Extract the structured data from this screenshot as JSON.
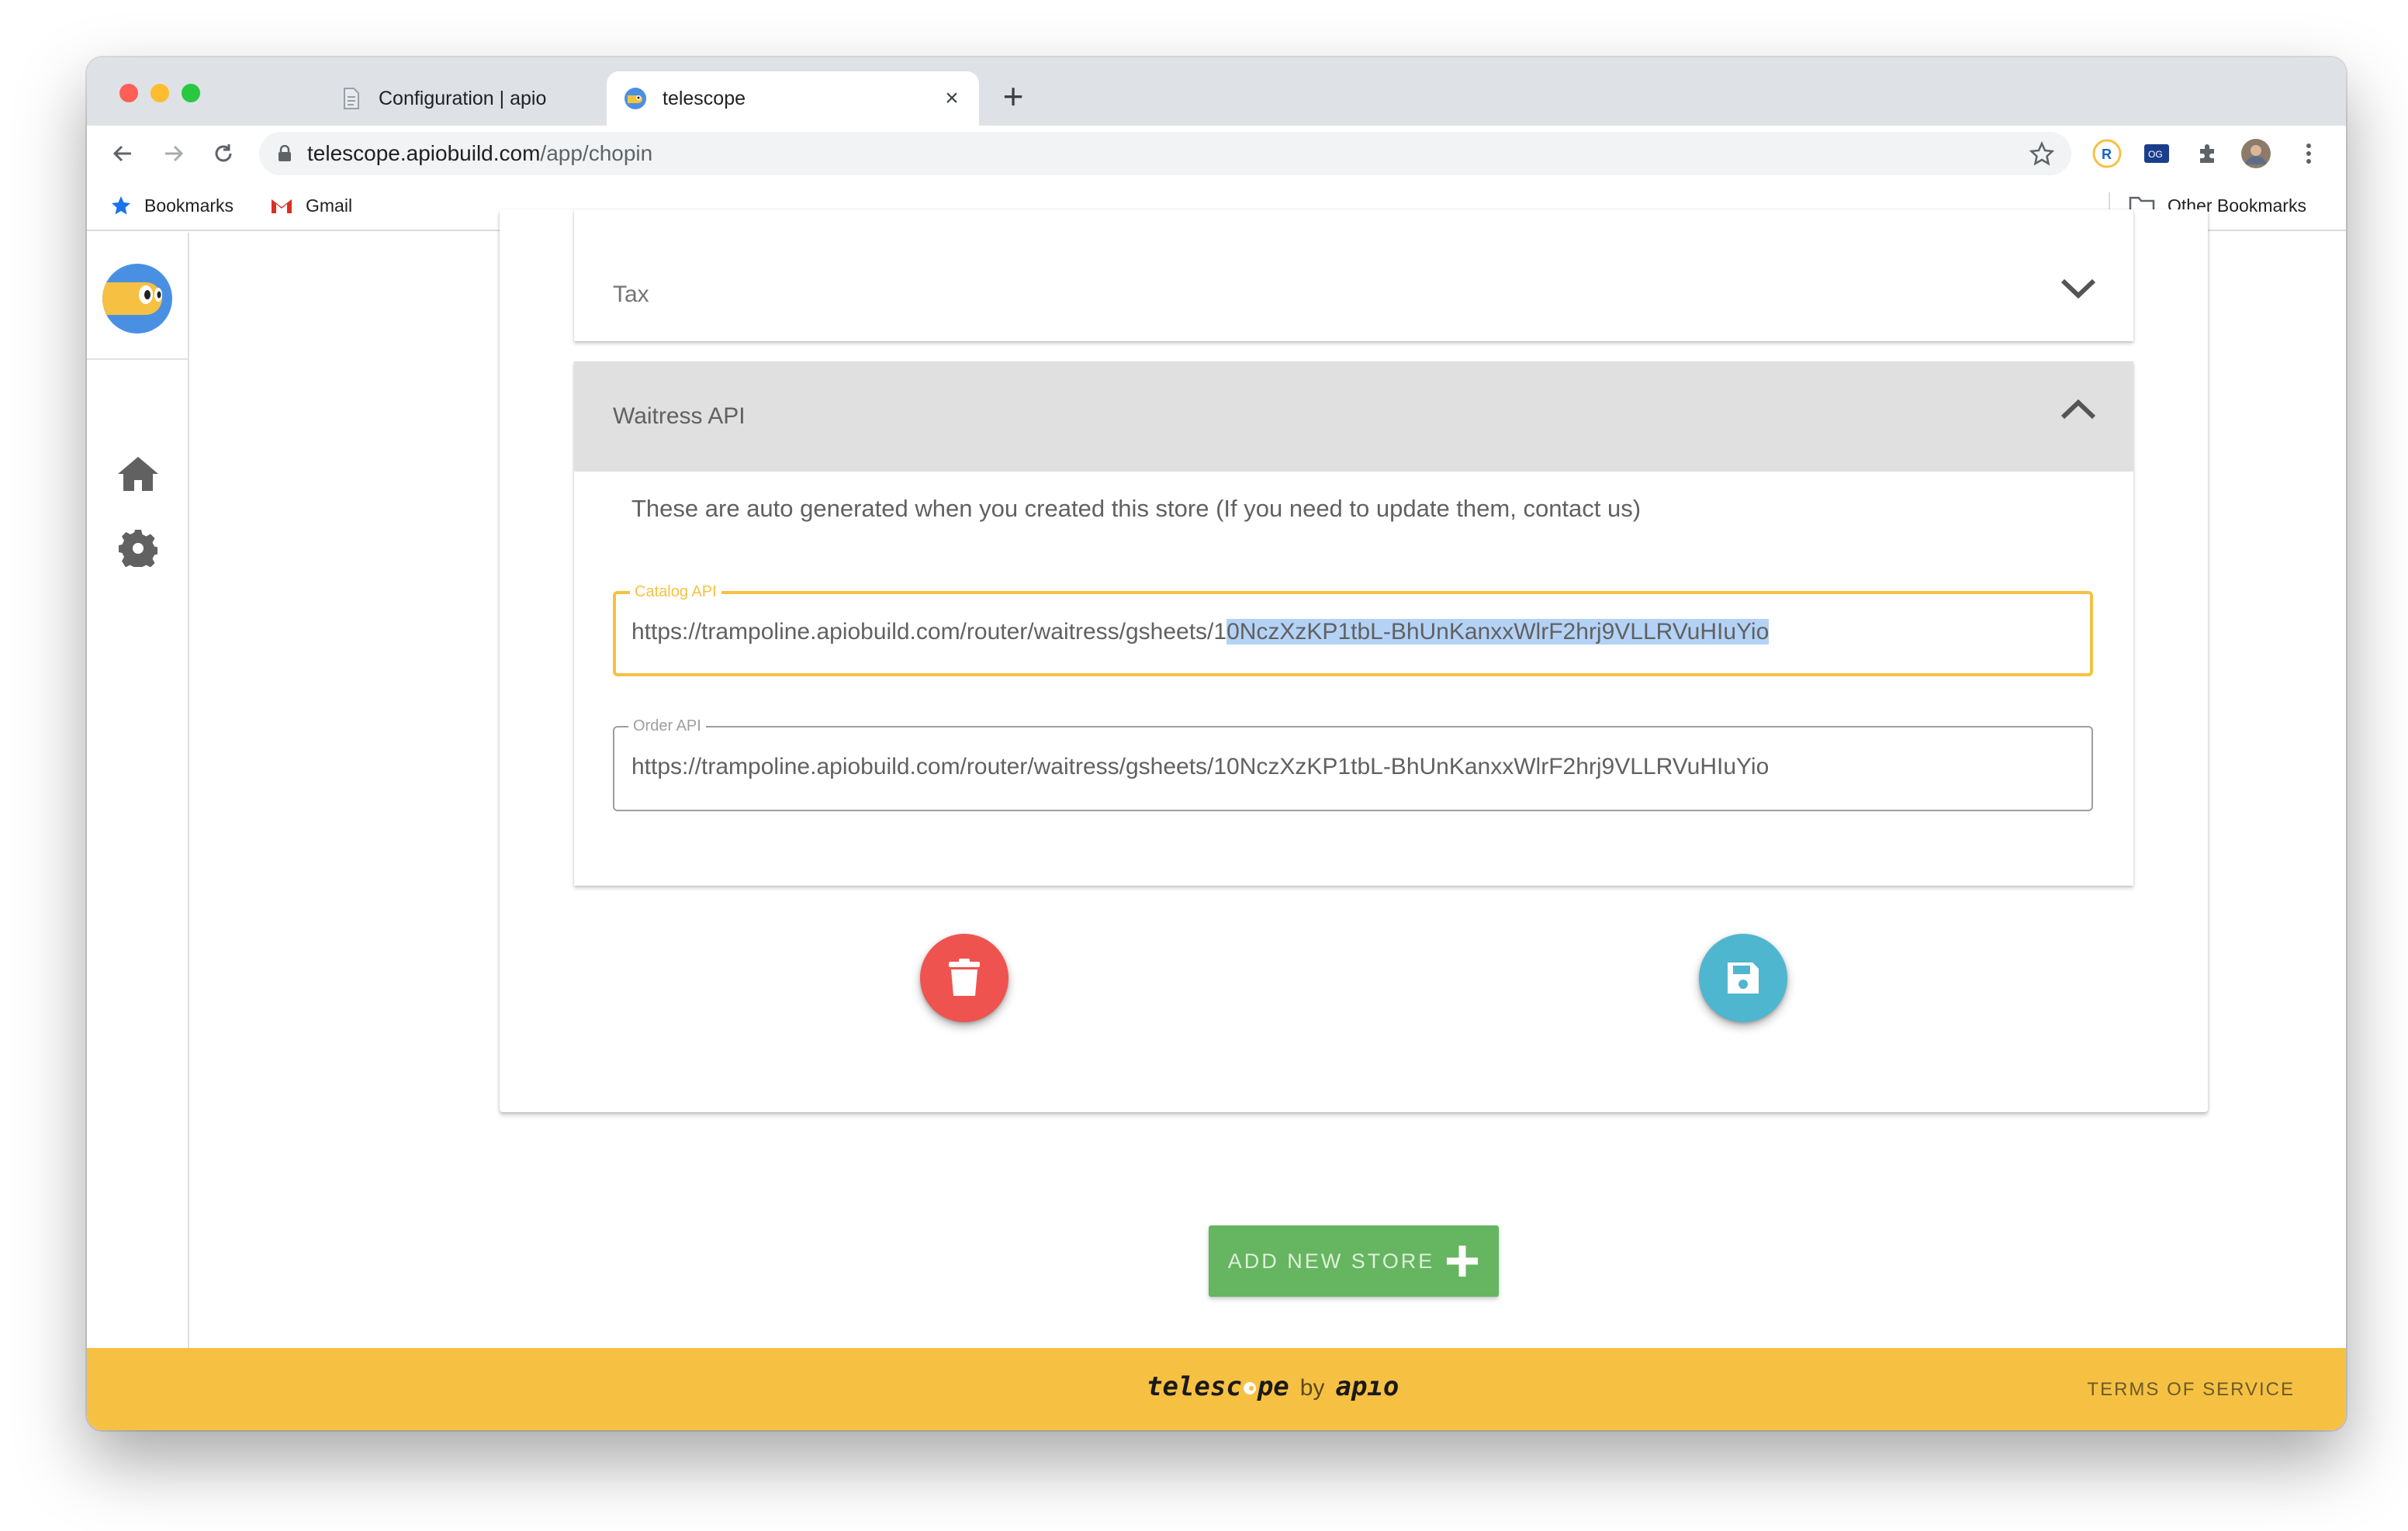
{
  "browser": {
    "tabs": [
      {
        "label": "Configuration | apio",
        "active": false
      },
      {
        "label": "telescope",
        "active": true
      }
    ],
    "url_host": "telescope.apiobuild.com",
    "url_path": "/app/chopin",
    "bookmarks": [
      {
        "label": "Bookmarks"
      },
      {
        "label": "Gmail"
      }
    ],
    "other_bookmarks": "Other Bookmarks"
  },
  "sidebar": {
    "items": [
      {
        "name": "home"
      },
      {
        "name": "settings"
      }
    ]
  },
  "panels": {
    "tax": {
      "title": "Tax",
      "expanded": false
    },
    "waitress": {
      "title": "Waitress API",
      "expanded": true,
      "description": "These are auto generated when you created this store (If you need to update them, contact us)",
      "catalog": {
        "label": "Catalog API",
        "value_prefix": "https://trampoline.apiobuild.com/router/waitress/gsheets/1",
        "value_selected": "0NczXzKP1tbL-BhUnKanxxWlrF2hrj9VLLRVuHIuYio"
      },
      "order": {
        "label": "Order API",
        "value": "https://trampoline.apiobuild.com/router/waitress/gsheets/10NczXzKP1tbL-BhUnKanxxWlrF2hrj9VLLRVuHIuYio"
      }
    }
  },
  "actions": {
    "add_store": "ADD NEW STORE"
  },
  "footer": {
    "brand_part1": "telesc",
    "brand_part2": "pe",
    "by": "by",
    "apio": "apıo",
    "tos": "TERMS OF SERVICE"
  },
  "colors": {
    "accent_yellow": "#f6c142",
    "delete_red": "#ef5350",
    "save_blue": "#4fb6cf",
    "add_green": "#66b560"
  }
}
